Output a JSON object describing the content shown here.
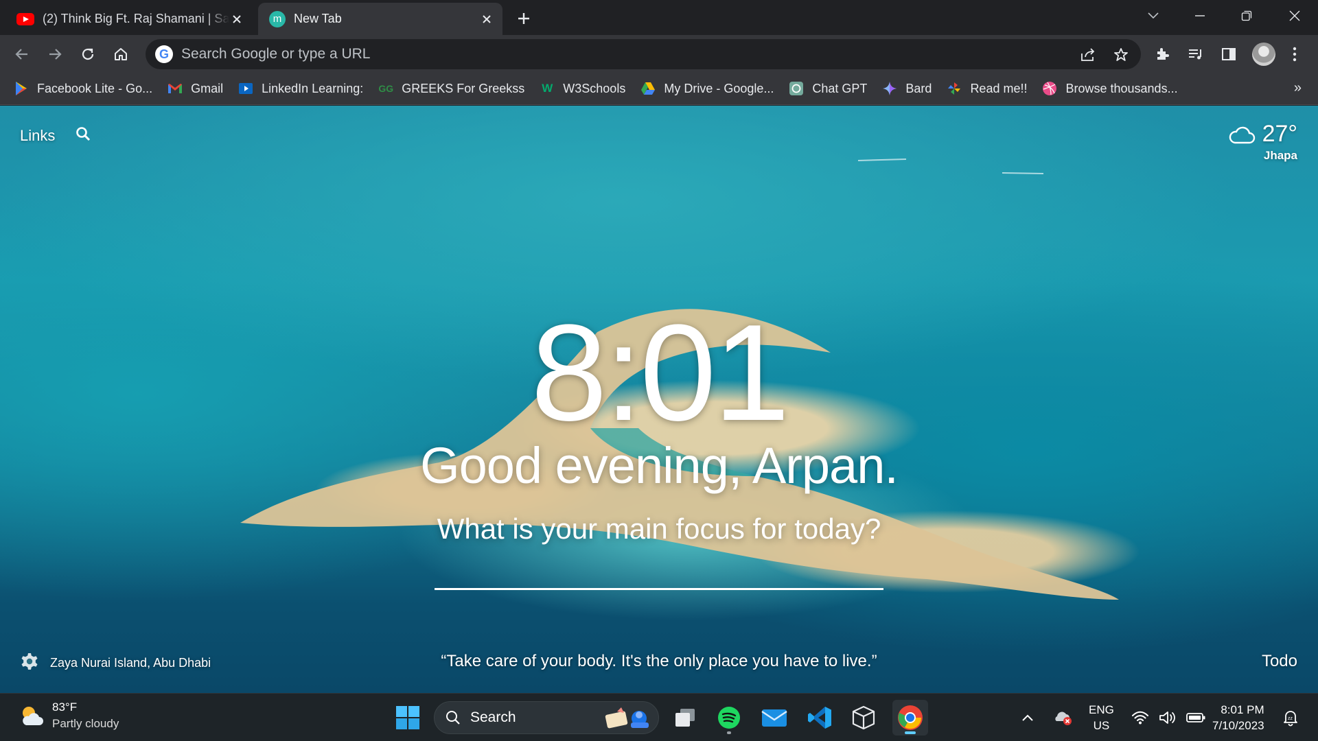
{
  "tabs": [
    {
      "title": "(2) Think Big Ft. Raj Shamani | Sar",
      "favicon": "youtube-icon",
      "active": false
    },
    {
      "title": "New Tab",
      "favicon": "momentum-icon",
      "active": true
    }
  ],
  "omnibox": {
    "placeholder": "Search Google or type a URL"
  },
  "bookmarks": [
    {
      "label": "Facebook Lite - Go...",
      "icon": "google-play-icon"
    },
    {
      "label": "Gmail",
      "icon": "gmail-icon"
    },
    {
      "label": "LinkedIn Learning:",
      "icon": "linkedin-learning-icon"
    },
    {
      "label": "GREEKS For Greekss",
      "icon": "geeksforgeeks-icon"
    },
    {
      "label": "W3Schools",
      "icon": "w3schools-icon"
    },
    {
      "label": "My Drive - Google...",
      "icon": "google-drive-icon"
    },
    {
      "label": "Chat GPT",
      "icon": "chatgpt-icon"
    },
    {
      "label": "Bard",
      "icon": "bard-icon"
    },
    {
      "label": "Read me!!",
      "icon": "pinwheel-icon"
    },
    {
      "label": "Browse thousands...",
      "icon": "dribbble-icon"
    }
  ],
  "momentum": {
    "links_label": "Links",
    "weather": {
      "temp": "27°",
      "location": "Jhapa"
    },
    "time": "8:01",
    "greeting": "Good evening, Arpan.",
    "focus_question": "What is your main focus for today?",
    "photo_location": "Zaya Nurai Island, Abu Dhabi",
    "quote": "“Take care of your body. It's the only place you have to live.”",
    "todo_label": "Todo"
  },
  "taskbar": {
    "weather": {
      "temp": "83°F",
      "condition": "Partly cloudy"
    },
    "search_label": "Search",
    "language": {
      "line1": "ENG",
      "line2": "US"
    },
    "time": "8:01 PM",
    "date": "7/10/2023"
  },
  "colors": {
    "chrome_dark": "#202124",
    "chrome_toolbar": "#35363a",
    "taskbar": "#1e2428",
    "accent": "#60cdff"
  }
}
